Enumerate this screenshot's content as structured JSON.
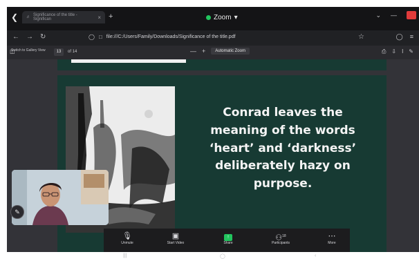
{
  "window": {
    "title": "Zoom",
    "dropdown": "▾"
  },
  "browser_tab": {
    "title": "Significance of the title - Significan",
    "close": "×",
    "new_tab": "+"
  },
  "address_bar": {
    "url": "file:///C:/Users/Family/Downloads/Significance of the title.pdf"
  },
  "pdf_toolbar": {
    "page_number": "13",
    "page_count": "of 14",
    "zoom_out": "—",
    "zoom_in": "+",
    "zoom_level": "Automatic Zoom"
  },
  "gallery": {
    "label": "Switch to Gallery View"
  },
  "slide": {
    "line1": "Conrad leaves the",
    "line2": "meaning of the words",
    "line3": "‘heart’ and ‘darkness’",
    "line4": "deliberately hazy on",
    "line5": "purpose."
  },
  "meeting_controls": {
    "unmute": "Unmute",
    "start_video": "Start Video",
    "share": "Share",
    "participants": "Participants",
    "participants_count": "18",
    "more": "More"
  },
  "colors": {
    "slide_bg": "#173a33",
    "share_green": "#22c55e",
    "zoom_dot": "#22c55e"
  }
}
